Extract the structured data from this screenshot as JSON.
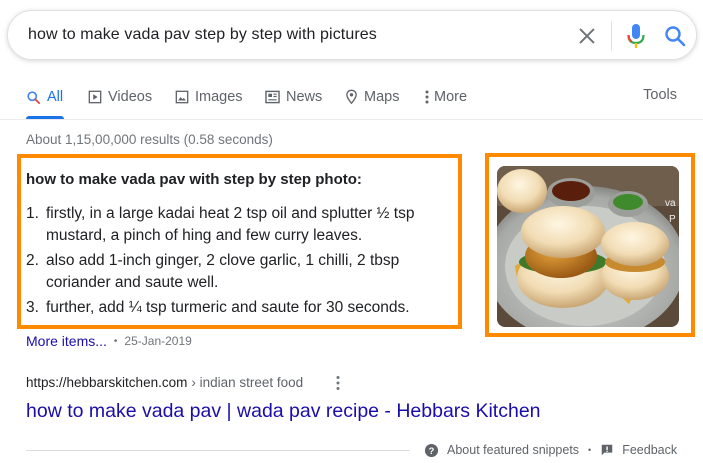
{
  "search": {
    "query": "how to make vada pav step by step with pictures"
  },
  "tabs": [
    {
      "label": "All",
      "icon": "search-icon",
      "active": true
    },
    {
      "label": "Videos",
      "icon": "video-icon"
    },
    {
      "label": "Images",
      "icon": "image-icon"
    },
    {
      "label": "News",
      "icon": "news-icon"
    },
    {
      "label": "Maps",
      "icon": "map-pin-icon"
    },
    {
      "label": "More",
      "icon": "vertical-dots-icon"
    }
  ],
  "tools_label": "Tools",
  "result_stats": "About 1,15,00,000 results (0.58 seconds)",
  "snippet": {
    "title": "how to make vada pav with step by step photo:",
    "items": [
      {
        "num": "1.",
        "text": "firstly, in a large kadai heat 2 tsp oil and splutter ½ tsp mustard, a pinch of hing and few curry leaves."
      },
      {
        "num": "2.",
        "text": "also add 1-inch ginger, 2 clove garlic, 1 chilli, 2 tbsp coriander and saute well."
      },
      {
        "num": "3.",
        "text": "further, add ¼ tsp turmeric and saute for 30 seconds."
      }
    ],
    "more_items": "More items...",
    "date": "25-Jan-2019",
    "image_caption_a": "va",
    "image_caption_b": "P"
  },
  "result": {
    "url": "https://hebbarskitchen.com",
    "breadcrumb": "› indian street food",
    "title": "how to make vada pav | wada pav recipe - Hebbars Kitchen"
  },
  "footer": {
    "about": "About featured snippets",
    "feedback": "Feedback"
  },
  "colors": {
    "highlight": "#ff8a00",
    "link": "#1a0dab",
    "accent": "#1a73e8"
  }
}
